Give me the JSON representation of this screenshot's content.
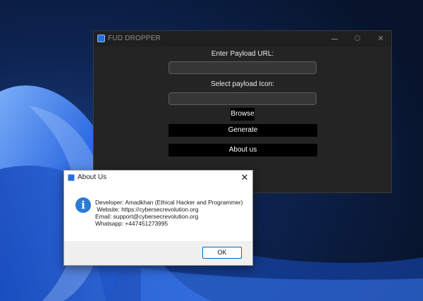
{
  "main_window": {
    "title": "FUD DROPPER",
    "url_label": "Enter Payload URL:",
    "url_value": "",
    "icon_label": "Select payload Icon:",
    "icon_value": "",
    "browse_label": "Browse",
    "generate_label": "Generate",
    "about_label": "About us",
    "controls": {
      "minimize": "minimize-icon",
      "maximize": "maximize-icon",
      "close": "close-icon"
    }
  },
  "about_dialog": {
    "title": "About Us",
    "close_glyph": "✕",
    "icon": "info-icon",
    "icon_glyph": "i",
    "lines": [
      "Developer: Amadkhan (Ethical Hacker and Programmer)",
      " Website: https://cybersecrevolution.org",
      "Email: support@cybersecrevolution.org",
      "Whatsapp: +447451273995"
    ],
    "ok_label": "OK"
  },
  "colors": {
    "main_bg": "#242424",
    "button_bg": "#000000",
    "accent": "#0067c0",
    "desktop_blue": "#1f5fd6"
  }
}
